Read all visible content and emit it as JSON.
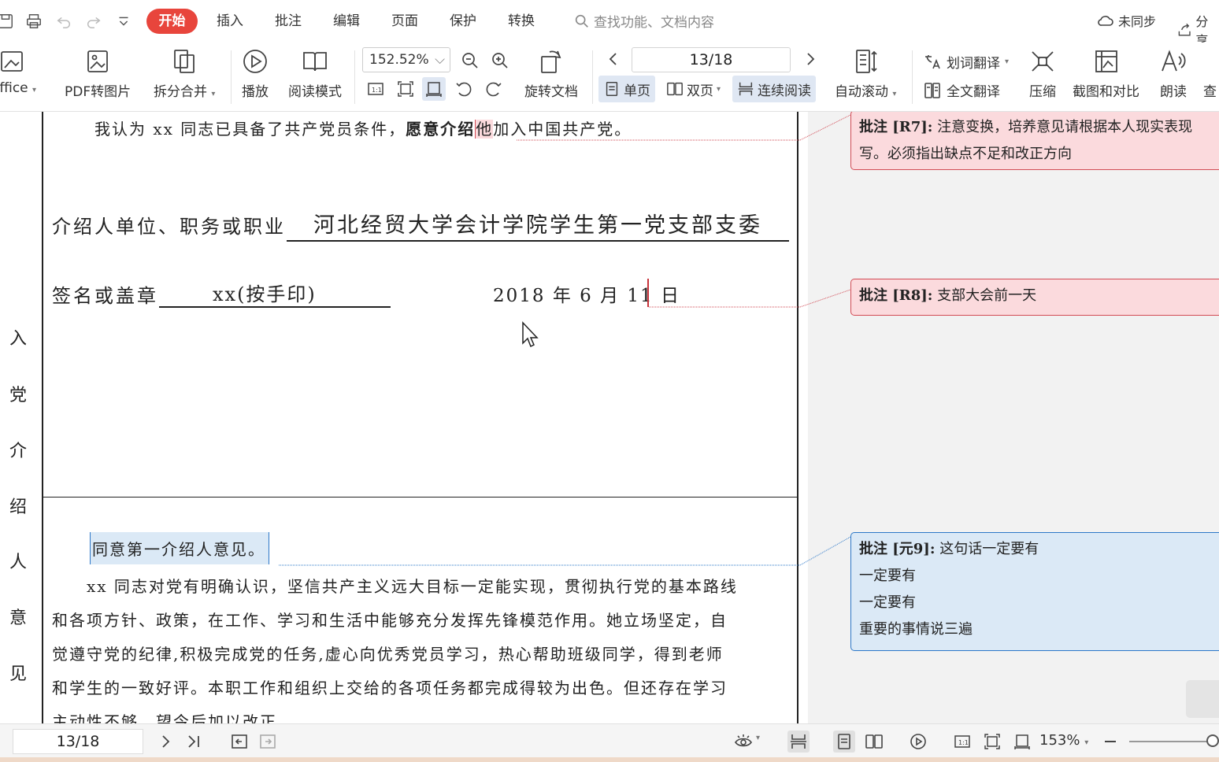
{
  "menubar": {
    "tabs": [
      "开始",
      "插入",
      "批注",
      "编辑",
      "页面",
      "保护",
      "转换"
    ],
    "search_placeholder": "查找功能、文档内容",
    "sync_label": "未同步",
    "share_label": "分享"
  },
  "ribbon": {
    "office_label": "Office",
    "pdf_to_image": "PDF转图片",
    "split_merge": "拆分合并",
    "play": "播放",
    "read_mode": "阅读模式",
    "zoom_value": "152.52%",
    "rotate_doc": "旋转文档",
    "page_field": "13/18",
    "single_page": "单页",
    "double_page": "双页",
    "continuous_read": "连续阅读",
    "auto_scroll": "自动滚动",
    "word_translate": "划词翻译",
    "full_translate": "全文翻译",
    "compress": "压缩",
    "screenshot_compare": "截图和对比",
    "read_aloud": "朗读",
    "search_short": "查"
  },
  "document": {
    "vertical_label": [
      "入",
      "党",
      "介",
      "绍",
      "人",
      "意",
      "见"
    ],
    "p1_before": "我认为 xx 同志已具备了共产党员条件，",
    "p1_bold": "愿意介绍",
    "p1_highlight": "他",
    "p1_after": "加入中国共产党。",
    "intro_label": "介绍人单位、职务或职业",
    "intro_value": "河北经贸大学会计学院学生第一党支部支委",
    "sign_label": "签名或盖章",
    "sign_value": "xx(按手印)",
    "date": "2018 年 6 月 11 日",
    "agree": "同意第一介绍人意见。",
    "para_lines": [
      "　　xx 同志对党有明确认识，坚信共产主义远大目标一定能实现，贯彻执行党的基本路线",
      "和各项方针、政策，在工作、学习和生活中能够充分发挥先锋模范作用。她立场坚定，自",
      "觉遵守党的纪律,积极完成党的任务,虚心向优秀党员学习，热心帮助班级同学，得到老师",
      "和学生的一致好评。本职工作和组织上交给的各项任务都完成得较为出色。但还存在学习",
      "主动性不够，望今后加以改正"
    ]
  },
  "comments": [
    {
      "title": "批注 [R7]:",
      "lines": [
        "注意变换，培养意见请根据本人现实表现",
        "写。必须指出缺点不足和改正方向"
      ]
    },
    {
      "title": "批注 [R8]:",
      "lines": [
        "支部大会前一天"
      ]
    },
    {
      "title": "批注 [元9]:",
      "lines": [
        "这句话一定要有",
        "一定要有",
        "一定要有",
        "重要的事情说三遍"
      ]
    }
  ],
  "statusbar": {
    "page": "13/18",
    "zoom": "153%"
  },
  "colors": {
    "accent_red": "#e8453c",
    "comment_red_bg": "#fbdadd",
    "comment_blue_bg": "#dbe9f6",
    "active_blue": "#dfe7f3"
  }
}
